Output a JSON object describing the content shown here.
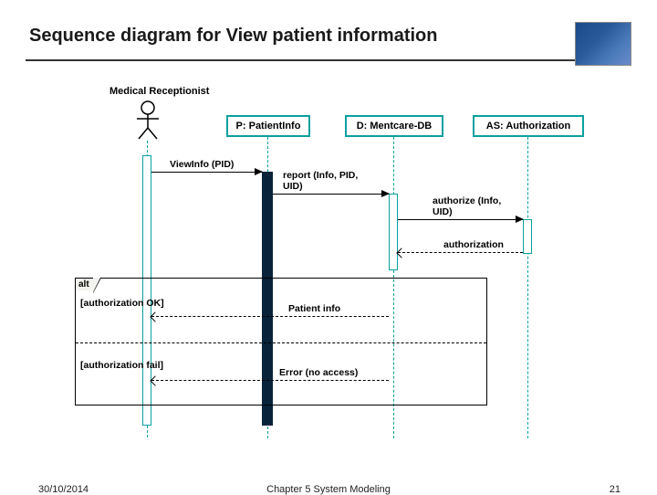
{
  "slide": {
    "title": "Sequence diagram for View patient information",
    "date": "30/10/2014",
    "chapter": "Chapter 5 System Modeling",
    "page": "21"
  },
  "diagram": {
    "actor": "Medical Receptionist",
    "participants": {
      "p": "P: PatientInfo",
      "d": "D: Mentcare-DB",
      "as": "AS: Authorization"
    },
    "messages": {
      "viewInfo": "ViewInfo (PID)",
      "report": "report (Info, PID,\nUID)",
      "authorize": "authorize (Info,\nUID)",
      "authorization": "authorization",
      "patientInfo": "Patient info",
      "error": "Error (no access)"
    },
    "alt": {
      "label": "alt",
      "guardOk": "[authorization OK]",
      "guardFail": "[authorization fail]"
    }
  }
}
